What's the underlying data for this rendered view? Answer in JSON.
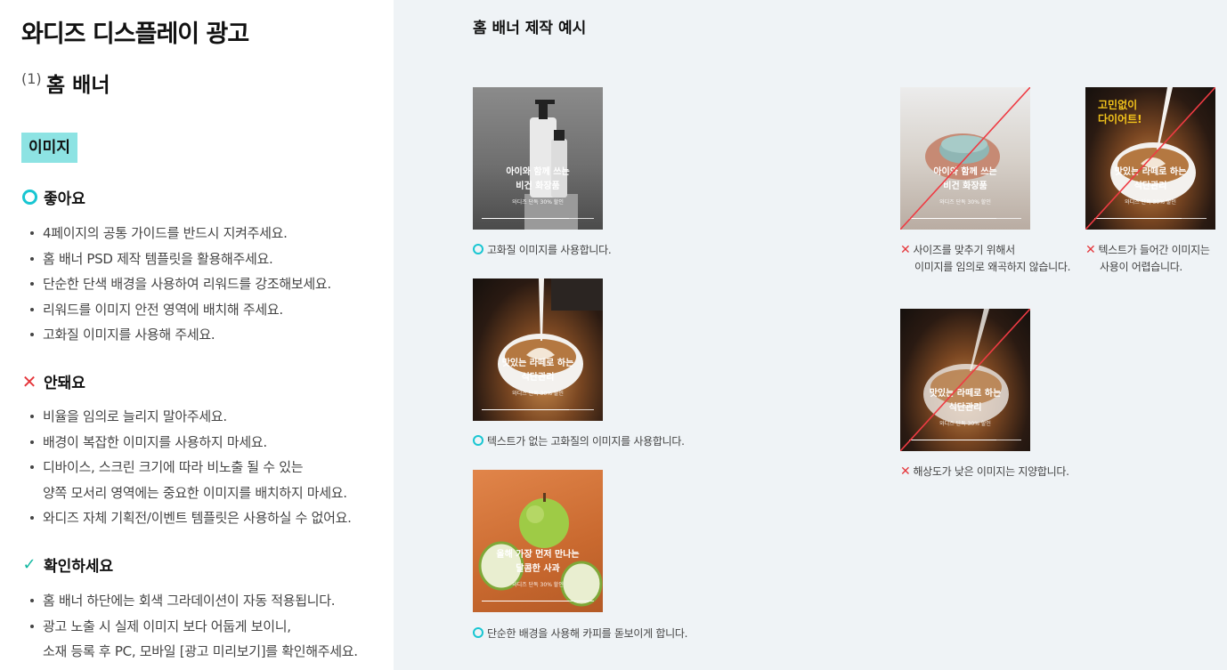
{
  "doc": {
    "title": "와디즈 디스플레이 광고",
    "sub_num": "(1)",
    "sub_title": "홈 배너",
    "chip": "이미지"
  },
  "good": {
    "heading": "좋아요",
    "items": [
      "4페이지의 공통 가이드를 반드시 지켜주세요.",
      "홈 배너 PSD 제작 템플릿을 활용해주세요.",
      "단순한 단색 배경을 사용하여 리워드를 강조해보세요.",
      "리워드를 이미지 안전 영역에 배치해 주세요.",
      "고화질 이미지를 사용해 주세요."
    ]
  },
  "bad": {
    "heading": "안돼요",
    "items": [
      "비율을 임의로 늘리지 말아주세요.",
      "배경이 복잡한 이미지를 사용하지 마세요.",
      "디바이스, 스크린 크기에 따라 비노출 될 수 있는",
      "양쪽 모서리 영역에는 중요한 이미지를 배치하지 마세요.",
      "와디즈 자체 기획전/이벤트 템플릿은 사용하실 수 없어요."
    ]
  },
  "check": {
    "heading": "확인하세요",
    "items": [
      "홈 배너 하단에는 회색 그라데이션이 자동 적용됩니다.",
      "광고 노출 시 실제 이미지 보다 어둡게 보이니,",
      "소재 등록 후 PC, 모바일 [광고 미리보기]를 확인해주세요."
    ]
  },
  "examples": {
    "title": "홈 배너 제작 예시",
    "cards": [
      {
        "line1": "아이와 함께 쓰는",
        "line2": "비건 화장품",
        "small": "와디즈 단독 30% 할인"
      },
      {
        "line1": "맛있는 라떼로 하는",
        "line2": "식단관리",
        "small": "와디즈 단독 30% 할인"
      },
      {
        "line1": "올해 가장 먼저 만나는",
        "line2": "달콤한 사과",
        "small": "와디즈 단독 30% 할인"
      },
      {
        "line1": "아이와 함께 쓰는",
        "line2": "비건 화장품",
        "small": "와디즈 단독 30% 할인"
      },
      {
        "line1": "맛있는 라떼로 하는",
        "line2": "식단관리",
        "small": "와디즈 단독 30% 할인",
        "overlay1": "고민없이",
        "overlay2": "다이어트!"
      },
      {
        "line1": "맛있는 라떼로 하는",
        "line2": "식단관리",
        "small": "와디즈 단독 30% 할인"
      }
    ],
    "captions": {
      "c1": "고화질 이미지를 사용합니다.",
      "c2": "텍스트가 없는 고화질의 이미지를 사용합니다.",
      "c3": "단순한 배경을 사용해 카피를 돋보이게 합니다.",
      "c4a": "사이즈를 맞추기 위해서",
      "c4b": "이미지를 임의로 왜곡하지 않습니다.",
      "c5a": "텍스트가 들어간 이미지는",
      "c5b": "사용이 어렵습니다.",
      "c6": "해상도가 낮은 이미지는 지양합니다."
    }
  },
  "colors": {
    "good": "#19c6d2",
    "bad": "#e5373c",
    "check": "#13b8a1",
    "chip": "#8de3e3",
    "panel": "#eff3f6"
  }
}
